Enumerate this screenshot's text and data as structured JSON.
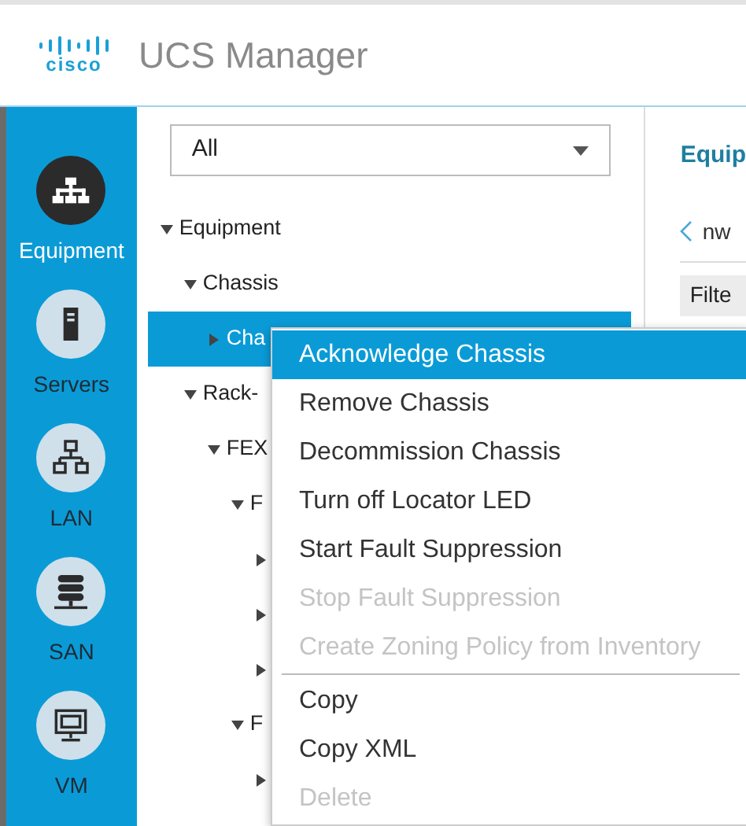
{
  "header": {
    "logo_text": "cisco",
    "title": "UCS Manager"
  },
  "nav": [
    {
      "label": "Equipment",
      "kind": "equipment",
      "selected": true
    },
    {
      "label": "Servers",
      "kind": "servers",
      "selected": false
    },
    {
      "label": "LAN",
      "kind": "lan",
      "selected": false
    },
    {
      "label": "SAN",
      "kind": "san",
      "selected": false
    },
    {
      "label": "VM",
      "kind": "vm",
      "selected": false
    }
  ],
  "filter": {
    "value": "All"
  },
  "tree": [
    {
      "label": "Equipment",
      "expanded": true,
      "selected": false,
      "children": [
        {
          "label": "Chassis",
          "expanded": true,
          "selected": false,
          "children": [
            {
              "label": "Cha",
              "expanded": false,
              "selected": true
            }
          ]
        },
        {
          "label": "Rack-",
          "expanded": true,
          "selected": false,
          "children": [
            {
              "label": "FEX",
              "expanded": true,
              "selected": false,
              "children": [
                {
                  "label": "F",
                  "expanded": true,
                  "selected": false,
                  "children": [
                    {
                      "expanded": false,
                      "selected": false
                    },
                    {
                      "expanded": false,
                      "selected": false
                    },
                    {
                      "expanded": false,
                      "selected": false
                    }
                  ]
                },
                {
                  "label": "F",
                  "expanded": true,
                  "selected": false,
                  "children": [
                    {
                      "expanded": false,
                      "selected": false
                    }
                  ]
                }
              ]
            }
          ]
        }
      ]
    }
  ],
  "detail": {
    "title": "Equip",
    "breadcrumb": "nw",
    "filter_button": "Filte"
  },
  "context_menu": [
    {
      "label": "Acknowledge Chassis",
      "selected": true,
      "disabled": false
    },
    {
      "label": "Remove Chassis",
      "selected": false,
      "disabled": false
    },
    {
      "label": "Decommission Chassis",
      "selected": false,
      "disabled": false
    },
    {
      "label": "Turn off Locator LED",
      "selected": false,
      "disabled": false
    },
    {
      "label": "Start Fault Suppression",
      "selected": false,
      "disabled": false
    },
    {
      "label": "Stop Fault Suppression",
      "selected": false,
      "disabled": true
    },
    {
      "label": "Create Zoning Policy from Inventory",
      "selected": false,
      "disabled": true
    },
    {
      "kind": "separator"
    },
    {
      "label": "Copy",
      "selected": false,
      "disabled": false
    },
    {
      "label": "Copy XML",
      "selected": false,
      "disabled": false
    },
    {
      "label": "Delete",
      "selected": false,
      "disabled": true
    }
  ]
}
